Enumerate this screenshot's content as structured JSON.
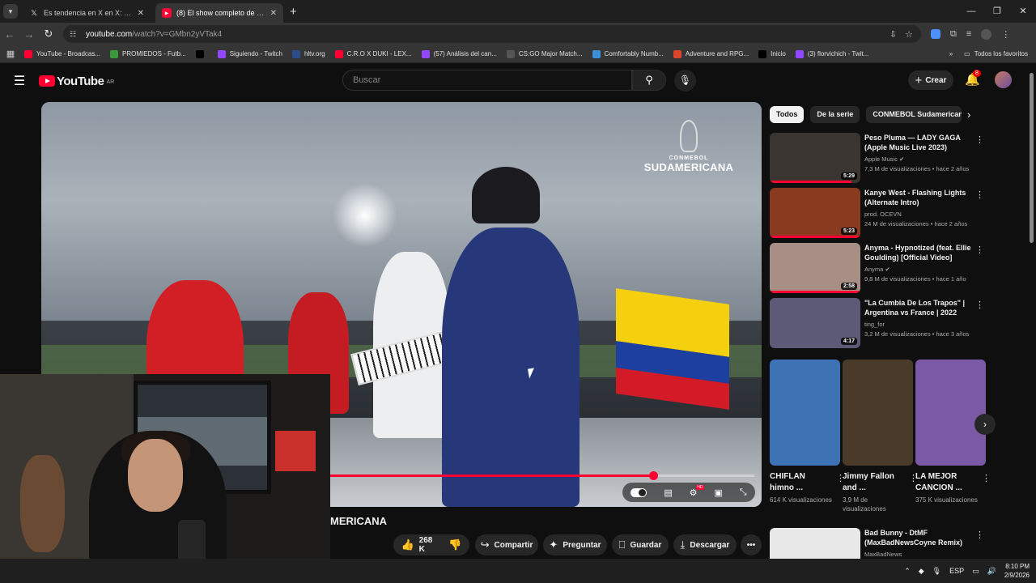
{
  "browser": {
    "tabs": [
      {
        "label": "Es tendencia en X en X: \"\"Harry",
        "icon": "x-logo-icon",
        "active": false
      },
      {
        "label": "(8) El show completo de LOS PALMERAS",
        "icon": "youtube-icon",
        "active": true
      }
    ],
    "url_host": "youtube.com",
    "url_path": "/watch?v=GMbn2yVTak4",
    "bookmarks": [
      {
        "label": "YouTube - Broadcas...",
        "icon": "youtube-icon",
        "color": "#ff0033"
      },
      {
        "label": "PROMIEDOS - Futb...",
        "icon": "promiedos-icon",
        "color": "#3a9a3a"
      },
      {
        "label": "",
        "icon": "x-logo-icon",
        "color": "#000000"
      },
      {
        "label": "Siguiendo - Twitch",
        "icon": "twitch-icon",
        "color": "#9146ff"
      },
      {
        "label": "hltv.org",
        "icon": "hltv-icon",
        "color": "#2b4d8a"
      },
      {
        "label": "C.R.O X DUKI - LEX...",
        "icon": "youtube-icon",
        "color": "#ff0033"
      },
      {
        "label": "(57) Análisis del can...",
        "icon": "twitch-icon",
        "color": "#9146ff"
      },
      {
        "label": "CS:GO Major Match...",
        "icon": "liquipedia-icon",
        "color": "#555555"
      },
      {
        "label": "Comfortably Numb...",
        "icon": "songsterr-icon",
        "color": "#3b8fd6"
      },
      {
        "label": "Adventure and RPG...",
        "icon": "game-icon",
        "color": "#d9452b"
      },
      {
        "label": "Inicio",
        "icon": "x-logo-icon",
        "color": "#000000"
      },
      {
        "label": "(3) florvichich - Twit...",
        "icon": "twitch-icon",
        "color": "#9146ff"
      }
    ],
    "all_bookmarks": "Todos los favoritos"
  },
  "youtube": {
    "logo_word": "YouTube",
    "country": "AR",
    "search_placeholder": "Buscar",
    "create_label": "Crear",
    "notif_count": "8"
  },
  "player": {
    "overlay_brand_top": "CONMEBOL",
    "overlay_brand_bottom": "SUDAMERICANA",
    "progress_fraction": 0.762,
    "title_visible": "MERICANA"
  },
  "actions": {
    "likes": "268 K",
    "share": "Compartir",
    "ask": "Preguntar",
    "save": "Guardar",
    "download": "Descargar"
  },
  "sidebar": {
    "chips": [
      "Todos",
      "De la serie",
      "CONMEBOL Sudamericana"
    ],
    "recommendations": [
      {
        "title": "Peso Pluma — LADY GAGA (Apple Music Live 2023)",
        "channel": "Apple Music",
        "verified": true,
        "views": "7,3 M de visualizaciones",
        "age": "hace 2 años",
        "duration": "5:29",
        "watched_fraction": 0.9,
        "thumb_color": "#3a3530"
      },
      {
        "title": "Kanye West - Flashing Lights (Alternate Intro)",
        "channel": "prod. OCEVN",
        "verified": false,
        "views": "24 M de visualizaciones",
        "age": "hace 2 años",
        "duration": "5:23",
        "watched_fraction": 1.0,
        "thumb_color": "#8a3a1f"
      },
      {
        "title": "Anyma - Hypnotized (feat. Ellie Goulding) [Official Video]",
        "channel": "Anyma",
        "verified": true,
        "views": "9,8 M de visualizaciones",
        "age": "hace 1 año",
        "duration": "2:58",
        "watched_fraction": 1.0,
        "thumb_color": "#a88f86"
      },
      {
        "title": "\"La Cumbia De Los Trapos\" | Argentina vs France | 2022 FIF...",
        "channel": "ting_for",
        "verified": false,
        "views": "3,2 M de visualizaciones",
        "age": "hace 3 años",
        "duration": "4:17",
        "watched_fraction": 0.0,
        "thumb_color": "#5d5a78"
      }
    ],
    "shorts": [
      {
        "title": "CHIFLAN himno ...",
        "views": "614 K visualizaciones",
        "thumb_color": "#3d72b5"
      },
      {
        "title": "Jimmy Fallon and ...",
        "views": "3,9 M de visualizaciones",
        "thumb_color": "#4a3a2a"
      },
      {
        "title": "LA MEJOR CANCION ...",
        "views": "375 K visualizaciones",
        "thumb_color": "#7a5aa6"
      }
    ],
    "last_rec": {
      "title": "Bad Bunny - DtMF (MaxBadNewsCoyne Remix)",
      "channel": "MaxBadNews"
    }
  },
  "taskbar": {
    "lang": "ESP",
    "time": "8:10 PM",
    "date": "2/9/2026"
  },
  "colors": {
    "accent": "#ff0033",
    "bg": "#0f0f0f",
    "chip": "#272727"
  }
}
